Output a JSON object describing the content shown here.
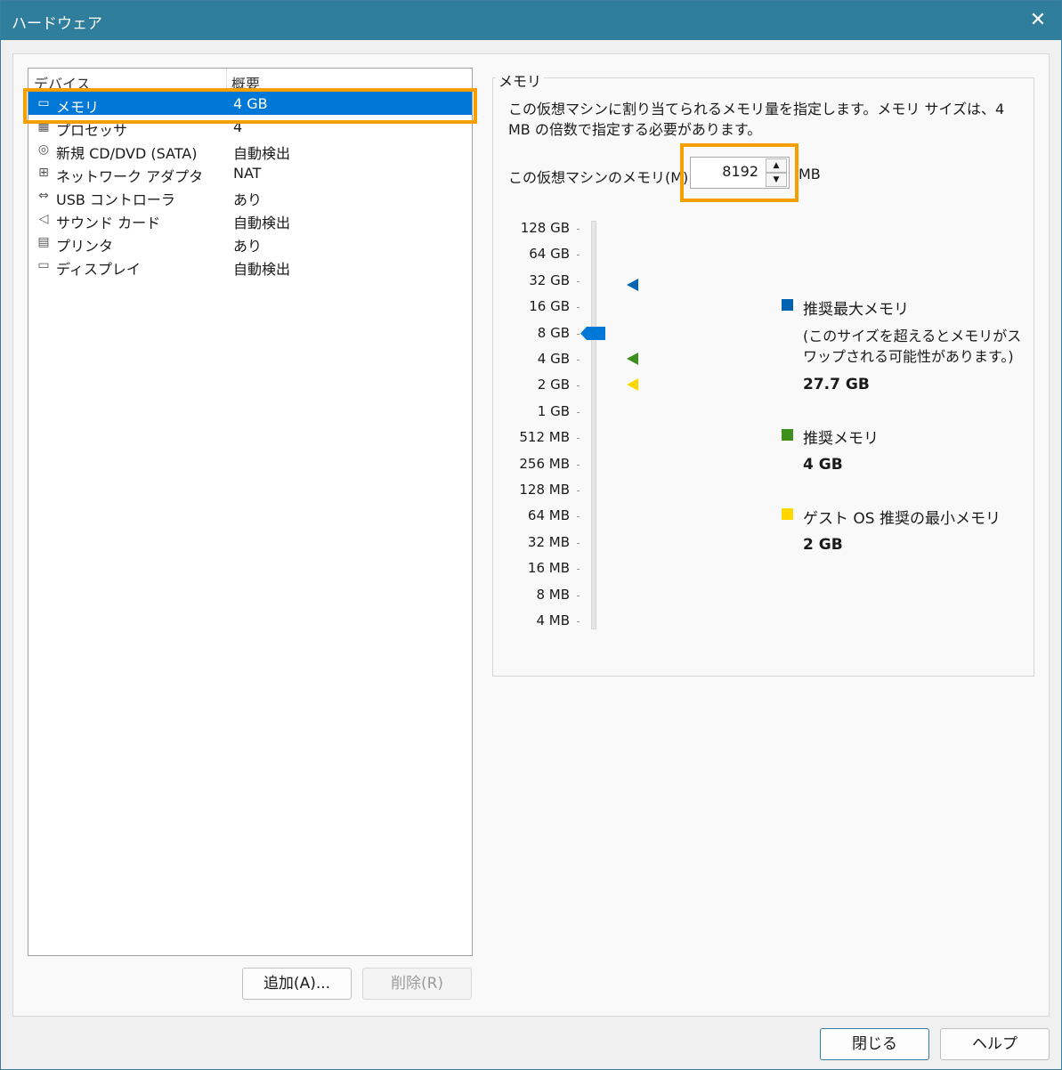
{
  "window": {
    "title": "ハードウェア",
    "close_glyph": "✕"
  },
  "devices": {
    "columns": [
      "デバイス",
      "概要"
    ],
    "items": [
      {
        "name": "メモリ",
        "value": "4 GB",
        "icon": "memory-icon",
        "glyph": "▭"
      },
      {
        "name": "プロセッサ",
        "value": "4",
        "icon": "processor-icon",
        "glyph": "▦"
      },
      {
        "name": "新規 CD/DVD (SATA)",
        "value": "自動検出",
        "icon": "cd-dvd-icon",
        "glyph": "◎"
      },
      {
        "name": "ネットワーク アダプタ",
        "value": "NAT",
        "icon": "network-adapter-icon",
        "glyph": "⊞"
      },
      {
        "name": "USB コントローラ",
        "value": "あり",
        "icon": "usb-icon",
        "glyph": "⇔"
      },
      {
        "name": "サウンド カード",
        "value": "自動検出",
        "icon": "sound-icon",
        "glyph": "◁"
      },
      {
        "name": "プリンタ",
        "value": "あり",
        "icon": "printer-icon",
        "glyph": "▤"
      },
      {
        "name": "ディスプレイ",
        "value": "自動検出",
        "icon": "display-icon",
        "glyph": "▭"
      }
    ],
    "selected_index": 0
  },
  "buttons": {
    "add": "追加(A)...",
    "remove": "削除(R)",
    "close": "閉じる",
    "help": "ヘルプ"
  },
  "memory": {
    "group_label": "メモリ",
    "description": "この仮想マシンに割り当てられるメモリ量を指定します。メモリ サイズは、4 MB の倍数で指定する必要があります。",
    "field_label": "この仮想マシンのメモリ(M):",
    "value": "8192",
    "unit": "MB",
    "spin_up_glyph": "▲",
    "spin_down_glyph": "▼",
    "scale": [
      "128 GB",
      "64 GB",
      "32 GB",
      "16 GB",
      "8 GB",
      "4 GB",
      "2 GB",
      "1 GB",
      "512 MB",
      "256 MB",
      "128 MB",
      "64 MB",
      "32 MB",
      "16 MB",
      "8 MB",
      "4 MB"
    ],
    "slider_value": "8 GB",
    "legend": {
      "max": {
        "title": "推奨最大メモリ",
        "note": "(このサイズを超えるとメモリがスワップされる可能性があります。)",
        "value": "27.7 GB",
        "color": "#0063b1"
      },
      "recommended": {
        "title": "推奨メモリ",
        "value": "4 GB",
        "color": "#3f8f1f"
      },
      "min": {
        "title": "ゲスト OS 推奨の最小メモリ",
        "value": "2 GB",
        "color": "#ffd800"
      }
    }
  },
  "highlight_color": "#f5a000"
}
